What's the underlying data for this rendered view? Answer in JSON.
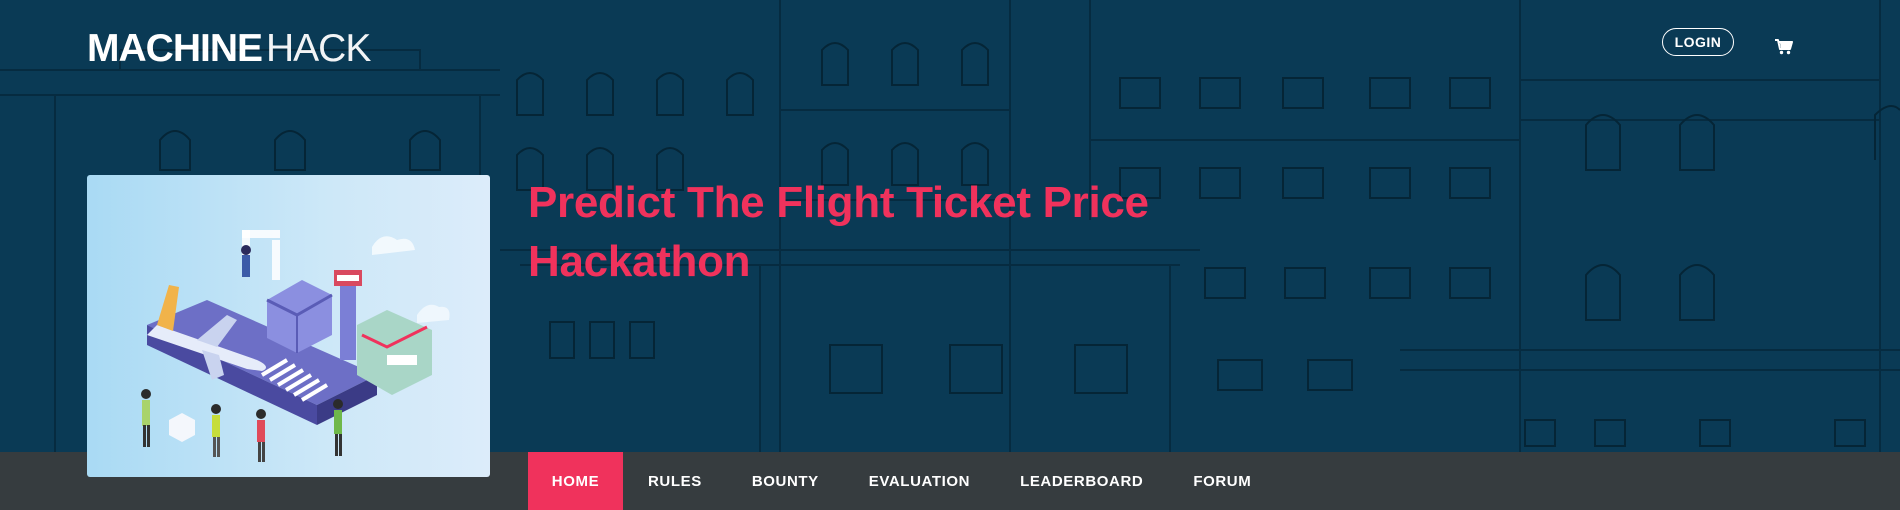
{
  "header": {
    "logo_bold": "MACHINE",
    "logo_light": "HACK",
    "login_label": "LOGIN",
    "cart_icon": "cart-icon"
  },
  "hero": {
    "title_line1": "Predict The Flight Ticket Price",
    "title_line2": "Hackathon",
    "thumbnail_icon": "airport-illustration"
  },
  "nav": {
    "items": [
      {
        "label": "HOME",
        "active": true
      },
      {
        "label": "RULES",
        "active": false
      },
      {
        "label": "BOUNTY",
        "active": false
      },
      {
        "label": "EVALUATION",
        "active": false
      },
      {
        "label": "LEADERBOARD",
        "active": false
      },
      {
        "label": "FORUM",
        "active": false
      }
    ]
  },
  "colors": {
    "hero_bg": "#0a3a55",
    "accent": "#f0325c",
    "nav_bg": "#363c3f"
  }
}
